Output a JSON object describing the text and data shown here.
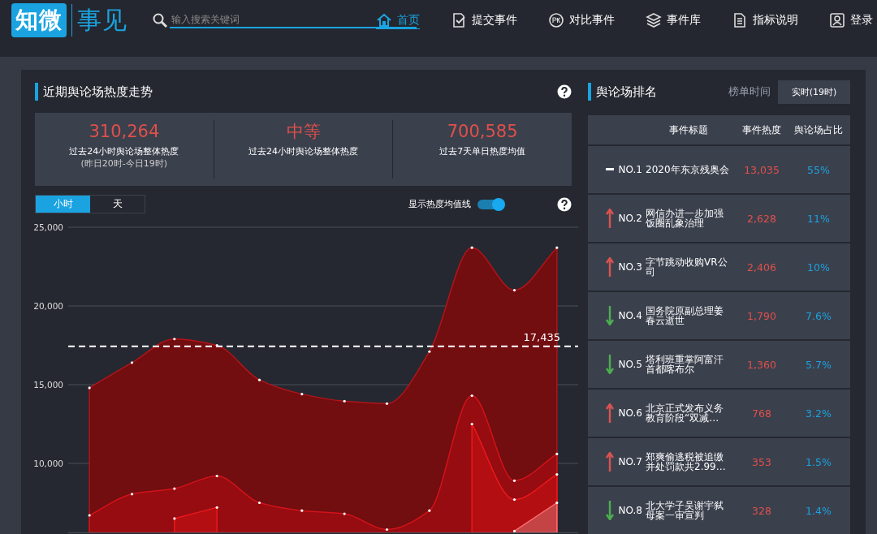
{
  "header": {
    "logo": {
      "left": "知微",
      "right": "事见"
    },
    "search": {
      "placeholder": "输入搜索关键词"
    },
    "nav": [
      {
        "label": "首页",
        "kind": "home",
        "selected": true
      },
      {
        "label": "提交事件",
        "kind": "submit",
        "selected": false
      },
      {
        "label": "对比事件",
        "kind": "compare",
        "selected": false
      },
      {
        "label": "事件库",
        "kind": "library",
        "selected": false
      },
      {
        "label": "指标说明",
        "kind": "guide",
        "selected": false
      },
      {
        "label": "登录",
        "kind": "login",
        "selected": false
      }
    ]
  },
  "trend": {
    "title": "近期舆论场热度走势",
    "stats": [
      {
        "value": "310,264",
        "label": "过去24小时舆论场整体热度",
        "note": "(昨日20时-今日19时)"
      },
      {
        "value": "中等",
        "label": "过去24小时舆论场整体热度"
      },
      {
        "value": "700,585",
        "label": "过去7天单日热度均值"
      }
    ],
    "tabs": [
      {
        "label": "小时",
        "selected": true
      },
      {
        "label": "天",
        "selected": false
      }
    ],
    "avg_toggle": {
      "label": "显示热度均值线",
      "on": true
    },
    "chart_data": {
      "type": "area",
      "ylim": [
        5600,
        25000
      ],
      "grid": true,
      "yticks": [
        {
          "value": 10000,
          "label": "10,000"
        },
        {
          "value": 15000,
          "label": "15,000"
        },
        {
          "value": 20000,
          "label": "20,000"
        },
        {
          "value": 25000,
          "label": "25,000"
        }
      ],
      "series": [
        {
          "color": "#720d10",
          "values": [
            14800,
            16400,
            17900,
            17500,
            15300,
            14400,
            13950,
            13800,
            17100,
            23700,
            21000,
            23700
          ]
        },
        {
          "color": "#960c10",
          "values": [
            6700,
            8050,
            8400,
            9200,
            7500,
            7000,
            6800,
            5800,
            7000,
            14300,
            8900,
            10600
          ]
        },
        {
          "color": "#b30f12",
          "values": [
            null,
            null,
            6500,
            7200,
            null,
            null,
            null,
            null,
            null,
            12500,
            7700,
            9300
          ]
        },
        {
          "color": "#c44446",
          "values": [
            null,
            null,
            null,
            null,
            null,
            null,
            null,
            null,
            null,
            null,
            5700,
            7500
          ]
        }
      ],
      "ref_lines": [
        {
          "axis": "y",
          "value": 17435,
          "label": "17,435"
        }
      ]
    }
  },
  "ranking": {
    "title": "舆论场排名",
    "time_label": "榜单时间",
    "time_button": "实时(19时)",
    "columns": [
      "事件标题",
      "事件热度",
      "舆论场占比"
    ],
    "rows": [
      {
        "rank": "NO.1",
        "kind": "flat",
        "title": "2020年东京残奥会",
        "heat": "13,035",
        "share": "55%"
      },
      {
        "rank": "NO.2",
        "kind": "up",
        "title": "网信办进一步加强饭圈乱象治理",
        "heat": "2,628",
        "share": "11%"
      },
      {
        "rank": "NO.3",
        "kind": "up",
        "title": "字节跳动收购VR公司",
        "heat": "2,406",
        "share": "10%"
      },
      {
        "rank": "NO.4",
        "kind": "down",
        "title": "国务院原副总理姜春云逝世",
        "heat": "1,790",
        "share": "7.6%"
      },
      {
        "rank": "NO.5",
        "kind": "down",
        "title": "塔利班重掌阿富汗首都喀布尔",
        "heat": "1,360",
        "share": "5.7%"
      },
      {
        "rank": "NO.6",
        "kind": "up",
        "title": "北京正式发布义务教育阶段“双减…",
        "heat": "768",
        "share": "3.2%"
      },
      {
        "rank": "NO.7",
        "kind": "up",
        "title": "郑爽偷逃税被追缴并处罚款共2.99…",
        "heat": "353",
        "share": "1.5%"
      },
      {
        "rank": "NO.8",
        "kind": "down",
        "title": "北大学子吴谢宇弑母案一审宣判",
        "heat": "328",
        "share": "1.4%"
      }
    ]
  }
}
